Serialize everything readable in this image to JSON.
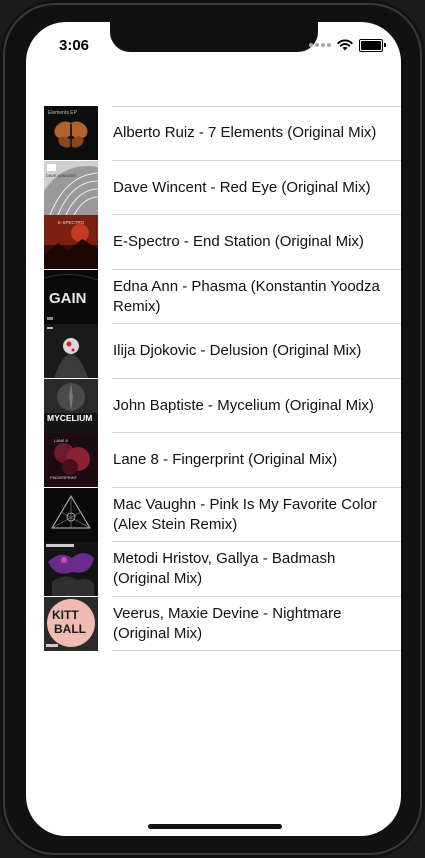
{
  "status_bar": {
    "time": "3:06"
  },
  "colors": {
    "separator": "#d6d6d6",
    "text": "#111111"
  },
  "tracks": [
    {
      "title": "Alberto Ruiz - 7 Elements (Original Mix)",
      "artwork_label": "Elements EP"
    },
    {
      "title": "Dave Wincent - Red Eye (Original Mix)",
      "artwork_label": "DAVE WINCENT"
    },
    {
      "title": "E-Spectro - End Station (Original Mix)",
      "artwork_label": "E-SPECTRO"
    },
    {
      "title": "Edna Ann - Phasma (Konstantin Yoodza Remix)",
      "artwork_label": "GAIN"
    },
    {
      "title": "Ilija Djokovic - Delusion (Original Mix)",
      "artwork_label": ""
    },
    {
      "title": "John Baptiste - Mycelium (Original Mix)",
      "artwork_label": "MYCELIUM"
    },
    {
      "title": "Lane 8 - Fingerprint (Original Mix)",
      "artwork_label": "FINGERPRINT"
    },
    {
      "title": "Mac Vaughn - Pink Is My Favorite Color (Alex Stein Remix)",
      "artwork_label": ""
    },
    {
      "title": "Metodi Hristov, Gallya - Badmash (Original Mix)",
      "artwork_label": ""
    },
    {
      "title": "Veerus, Maxie Devine - Nightmare (Original Mix)",
      "artwork_label": "KITT BALL"
    }
  ]
}
